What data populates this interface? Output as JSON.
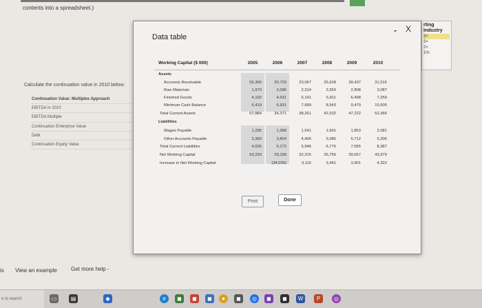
{
  "background": {
    "intro_text": "contents into a spreadsheet.)",
    "calc_prompt": "Calculate the continuation value in 2010 below:",
    "calc_rows": [
      {
        "label": "Continuation Value: Multiples Approach",
        "bold": true
      },
      {
        "label": "EBITDA in 2010",
        "bold": false
      },
      {
        "label": "EBITDA Multiple",
        "bold": false
      },
      {
        "label": "Continuation Enterprise Value",
        "bold": false
      },
      {
        "label": "Debt",
        "bold": false
      },
      {
        "label": "Continuation Equity Value",
        "bold": false
      }
    ],
    "right_panel": {
      "heading": "rting Industry",
      "values": [
        "3×",
        "3×",
        "2×",
        "1%"
      ]
    },
    "bottom_cut": "is",
    "view_example": "View an example",
    "get_help": "Get more help -"
  },
  "taskbar": {
    "search_text": "e to search"
  },
  "modal": {
    "title": "Data table",
    "minimize": "-",
    "close": "X",
    "header_label": "Working Capital ($ 000)",
    "years": [
      "2005",
      "2006",
      "2007",
      "2008",
      "2009",
      "2010"
    ],
    "rows": [
      {
        "label": "Assets",
        "type": "section",
        "values": [
          "",
          "",
          "",
          "",
          "",
          ""
        ]
      },
      {
        "label": "Accounts Receivable",
        "type": "item",
        "values": [
          "55,300",
          "20,733",
          "23,067",
          "25,628",
          "28,437",
          "31,515"
        ]
      },
      {
        "label": "Raw Materials",
        "type": "item",
        "values": [
          "1,973",
          "2,096",
          "2,314",
          "2,550",
          "2,808",
          "3,087"
        ]
      },
      {
        "label": "Finished Goods",
        "type": "item",
        "values": [
          "4,192",
          "4,631",
          "5,191",
          "5,811",
          "6,498",
          "7,259"
        ]
      },
      {
        "label": "Minimum Cash Balance",
        "type": "item",
        "values": [
          "6,419",
          "6,931",
          "7,689",
          "8,543",
          "9,479",
          "10,505"
        ]
      },
      {
        "label": "Total Current Assets",
        "type": "sub",
        "values": [
          "67,884",
          "34,371",
          "38,261",
          "42,532",
          "47,222",
          "52,366"
        ]
      },
      {
        "label": "Liabilities",
        "type": "section",
        "values": [
          "",
          "",
          "",
          "",
          "",
          ""
        ]
      },
      {
        "label": "Wages Payable",
        "type": "item",
        "values": [
          "1,295",
          "1,368",
          "1,541",
          "1,691",
          "1,853",
          "2,081"
        ]
      },
      {
        "label": "Other Accounts Payable",
        "type": "item",
        "values": [
          "3,360",
          "3,804",
          "4,405",
          "5,085",
          "5,712",
          "6,306"
        ]
      },
      {
        "label": "Total Current Liabilities",
        "type": "sub",
        "values": [
          "4,655",
          "5,172",
          "5,946",
          "6,776",
          "7,565",
          "8,387"
        ]
      },
      {
        "label": "Net Working Capital",
        "type": "sub",
        "values": [
          "63,229",
          "29,199",
          "32,315",
          "35,756",
          "39,657",
          "43,979"
        ]
      },
      {
        "label": "Increase in Net Working Capital",
        "type": "sub",
        "values": [
          "",
          "(34,030)",
          "3,116",
          "3,441",
          "3,901",
          "4,322"
        ]
      }
    ],
    "print_label": "Print",
    "done_label": "Done"
  }
}
